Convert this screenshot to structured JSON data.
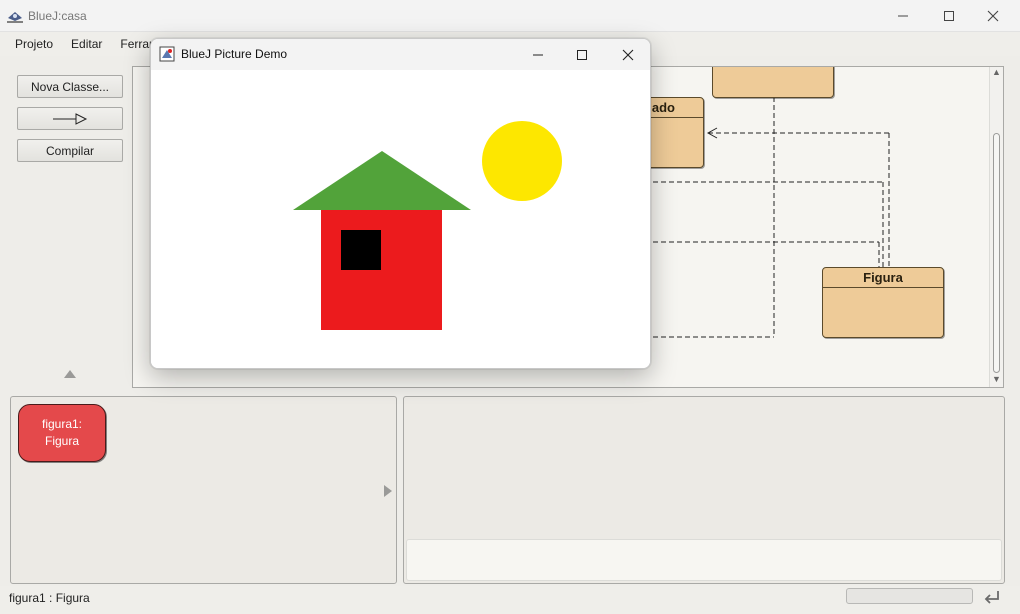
{
  "main_window": {
    "title": "BlueJ:casa",
    "buttons": [
      "minimize",
      "maximize",
      "close"
    ]
  },
  "menubar": {
    "items": [
      "Projeto",
      "Editar",
      "Ferramentas"
    ]
  },
  "toolbar": {
    "new_class_label": "Nova Classe...",
    "arrow_icon": "inheritance-arrow-icon",
    "compile_label": "Compilar"
  },
  "diagram": {
    "classes": [
      {
        "name": "Figura"
      },
      {
        "name": "ado"
      },
      {
        "name": ""
      }
    ]
  },
  "object_bench": {
    "objects": [
      {
        "line1": "figura1:",
        "line2": "Figura"
      }
    ]
  },
  "statusbar": {
    "text": "figura1 : Figura"
  },
  "picture_window": {
    "title": "BlueJ Picture Demo",
    "buttons": [
      "minimize",
      "maximize",
      "close"
    ],
    "colors": {
      "roof": "#52a33a",
      "wall": "#ec1b1d",
      "window": "#000000",
      "sun": "#fde700"
    }
  }
}
